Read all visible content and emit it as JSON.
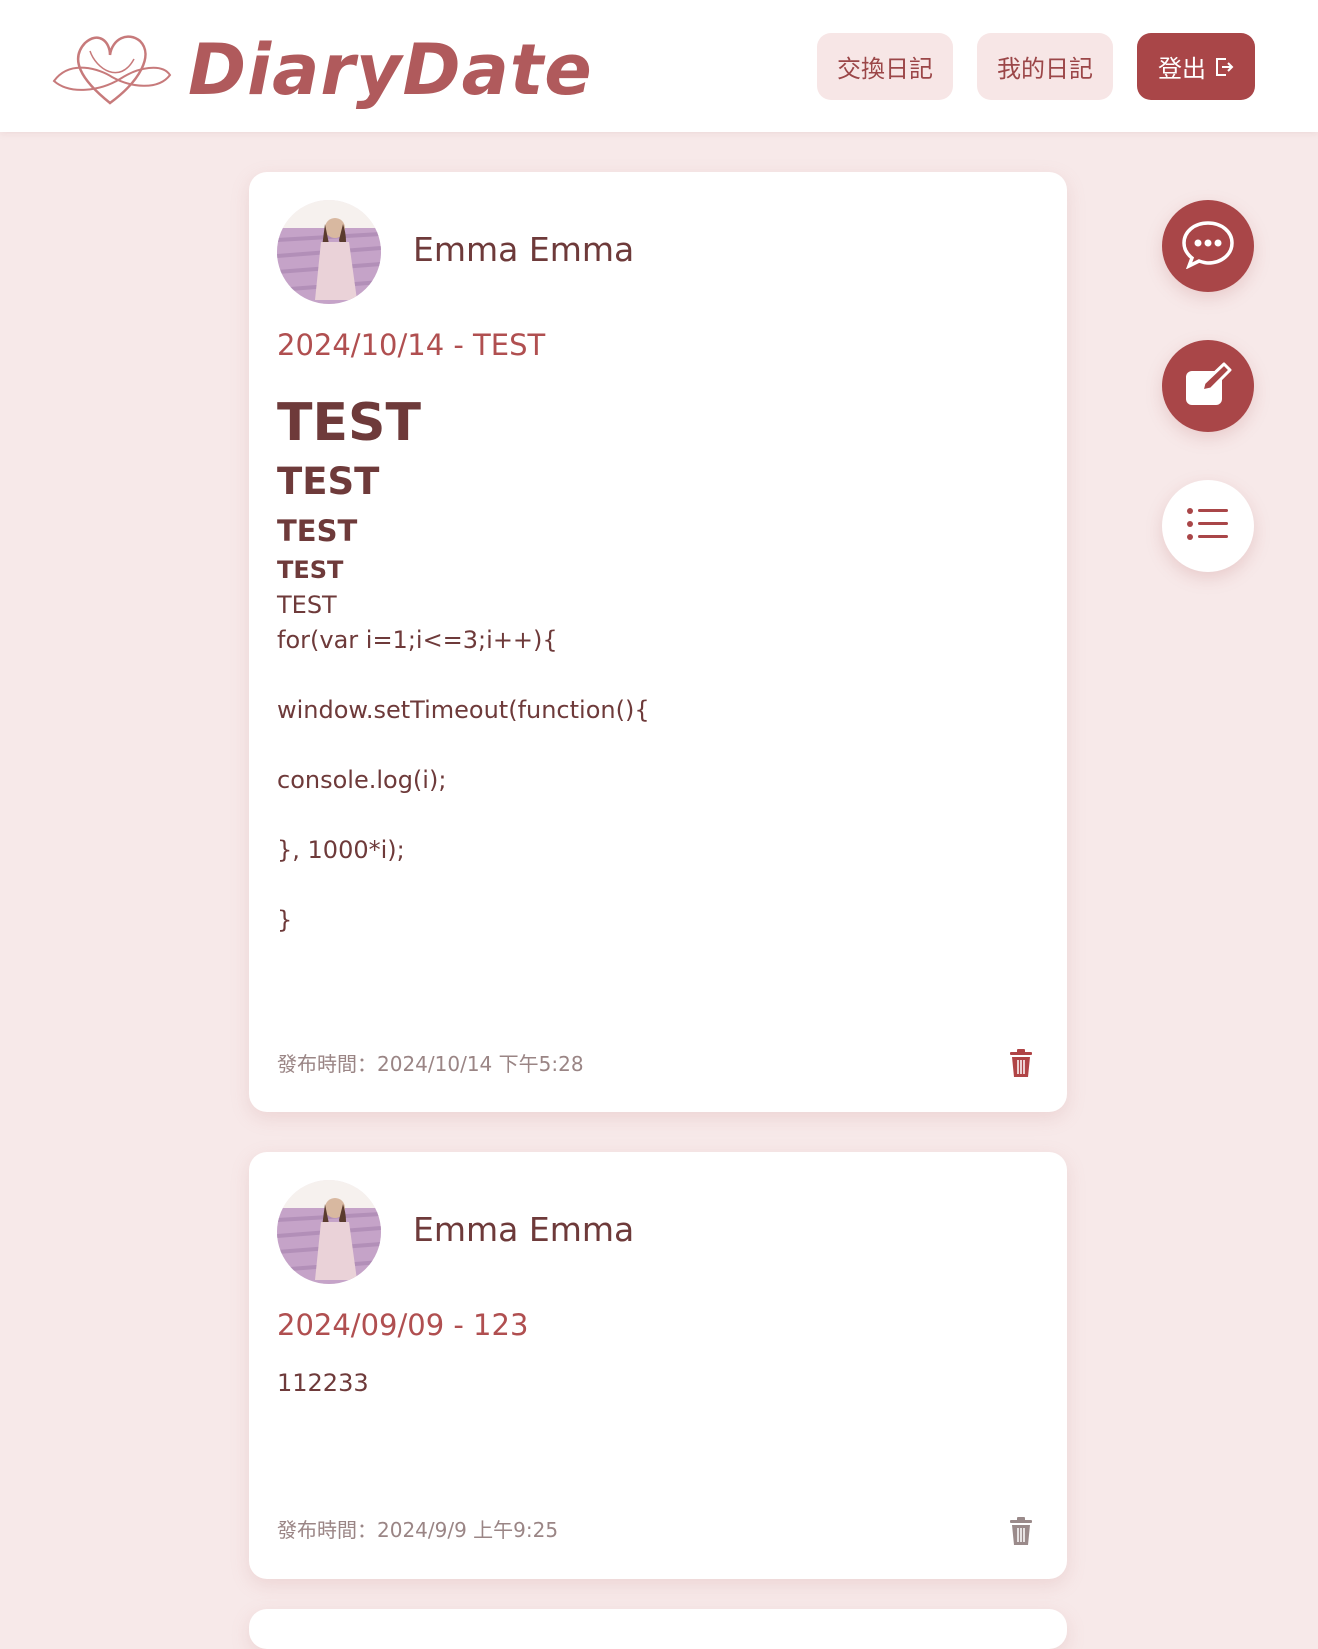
{
  "header": {
    "brand": "DiaryDate",
    "nav": {
      "exchange_label": "交換日記",
      "mine_label": "我的日記",
      "logout_label": "登出"
    }
  },
  "entries": [
    {
      "author": "Emma Emma",
      "title": "2024/10/14 - TEST",
      "content": {
        "headings": [
          "TEST",
          "TEST",
          "TEST",
          "TEST"
        ],
        "paragraph": "TEST",
        "code": [
          "for(var i=1;i<=3;i++){",
          "window.setTimeout(function(){",
          "console.log(i);",
          "}, 1000*i);",
          "}"
        ]
      },
      "published": "發布時間：2024/10/14 下午5:28",
      "delete_icon": "trash-icon"
    },
    {
      "author": "Emma Emma",
      "title": "2024/09/09 - 123",
      "content": {
        "paragraph": "112233"
      },
      "published": "發布時間：2024/9/9 上午9:25",
      "delete_icon": "trash-icon"
    }
  ],
  "fabs": [
    {
      "icon": "chat-icon"
    },
    {
      "icon": "edit-icon"
    },
    {
      "icon": "list-icon"
    }
  ],
  "colors": {
    "accent": "#a94648",
    "background": "#f7e9e9",
    "text": "#6e3a3a",
    "title": "#b04f50"
  }
}
